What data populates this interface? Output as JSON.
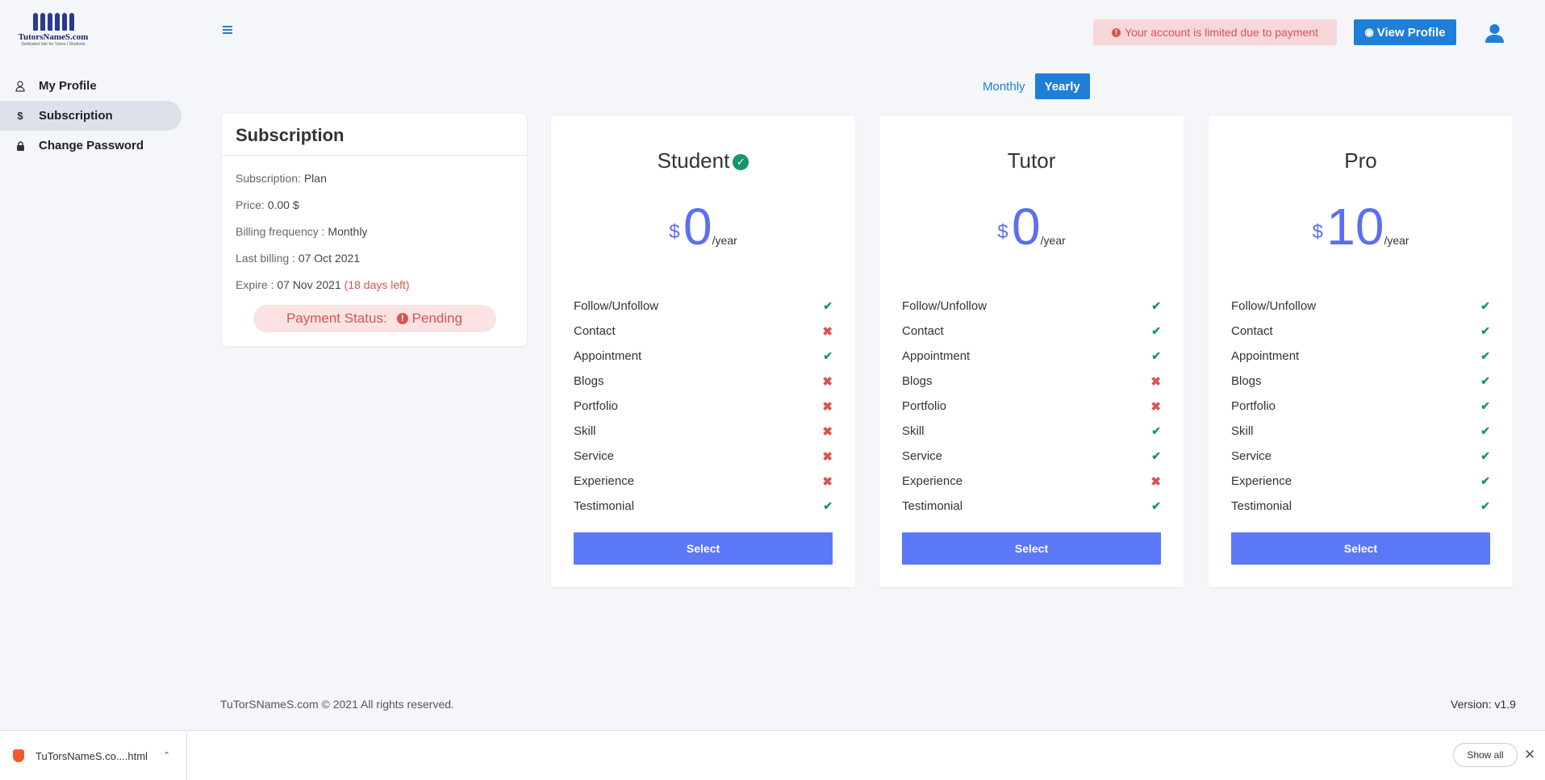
{
  "brand": {
    "logo_text": "TutorsNameS.com",
    "logo_sub": "Dedicated Site for Tutors / Students"
  },
  "sidebar": {
    "items": [
      {
        "label": "My Profile",
        "icon": "user-icon"
      },
      {
        "label": "Subscription",
        "icon": "dollar-icon",
        "active": true
      },
      {
        "label": "Change Password",
        "icon": "lock-icon"
      }
    ]
  },
  "header": {
    "alert": "Your account is limited due to payment",
    "view_profile": "View Profile"
  },
  "toggle": {
    "monthly": "Monthly",
    "yearly": "Yearly",
    "selected": "Yearly"
  },
  "subscription": {
    "title": "Subscription",
    "plan_label": "Subscription:",
    "plan_value": "Plan",
    "price_label": "Price:",
    "price_value": "0.00 $",
    "billing_label": "Billing frequency :",
    "billing_value": "Monthly",
    "last_label": "Last billing :",
    "last_value": "07 Oct 2021",
    "expire_label": "Expire :",
    "expire_value": "07 Nov 2021",
    "days_left": "(18 days left)",
    "status_label": "Payment Status:",
    "status_value": "Pending"
  },
  "plans": [
    {
      "name": "Student",
      "current": true,
      "currency": "$",
      "amount": "0",
      "period": "/year",
      "select": "Select",
      "features": [
        {
          "label": "Follow/Unfollow",
          "ok": true
        },
        {
          "label": "Contact",
          "ok": false
        },
        {
          "label": "Appointment",
          "ok": true
        },
        {
          "label": "Blogs",
          "ok": false
        },
        {
          "label": "Portfolio",
          "ok": false
        },
        {
          "label": "Skill",
          "ok": false
        },
        {
          "label": "Service",
          "ok": false
        },
        {
          "label": "Experience",
          "ok": false
        },
        {
          "label": "Testimonial",
          "ok": true
        }
      ]
    },
    {
      "name": "Tutor",
      "current": false,
      "currency": "$",
      "amount": "0",
      "period": "/year",
      "select": "Select",
      "features": [
        {
          "label": "Follow/Unfollow",
          "ok": true
        },
        {
          "label": "Contact",
          "ok": true
        },
        {
          "label": "Appointment",
          "ok": true
        },
        {
          "label": "Blogs",
          "ok": false
        },
        {
          "label": "Portfolio",
          "ok": false
        },
        {
          "label": "Skill",
          "ok": true
        },
        {
          "label": "Service",
          "ok": true
        },
        {
          "label": "Experience",
          "ok": false
        },
        {
          "label": "Testimonial",
          "ok": true
        }
      ]
    },
    {
      "name": "Pro",
      "current": false,
      "currency": "$",
      "amount": "10",
      "period": "/year",
      "select": "Select",
      "features": [
        {
          "label": "Follow/Unfollow",
          "ok": true
        },
        {
          "label": "Contact",
          "ok": true
        },
        {
          "label": "Appointment",
          "ok": true
        },
        {
          "label": "Blogs",
          "ok": true
        },
        {
          "label": "Portfolio",
          "ok": true
        },
        {
          "label": "Skill",
          "ok": true
        },
        {
          "label": "Service",
          "ok": true
        },
        {
          "label": "Experience",
          "ok": true
        },
        {
          "label": "Testimonial",
          "ok": true
        }
      ]
    }
  ],
  "footer": {
    "copyright": "TuTorSNameS.com © 2021 All rights reserved.",
    "version": "Version: v1.9"
  },
  "download_bar": {
    "filename": "TuTorsNameS.co....html",
    "show_all": "Show all"
  },
  "colors": {
    "primary": "#1e7ed8",
    "accent": "#5b78f6",
    "success": "#16966a",
    "danger": "#d9534f"
  }
}
